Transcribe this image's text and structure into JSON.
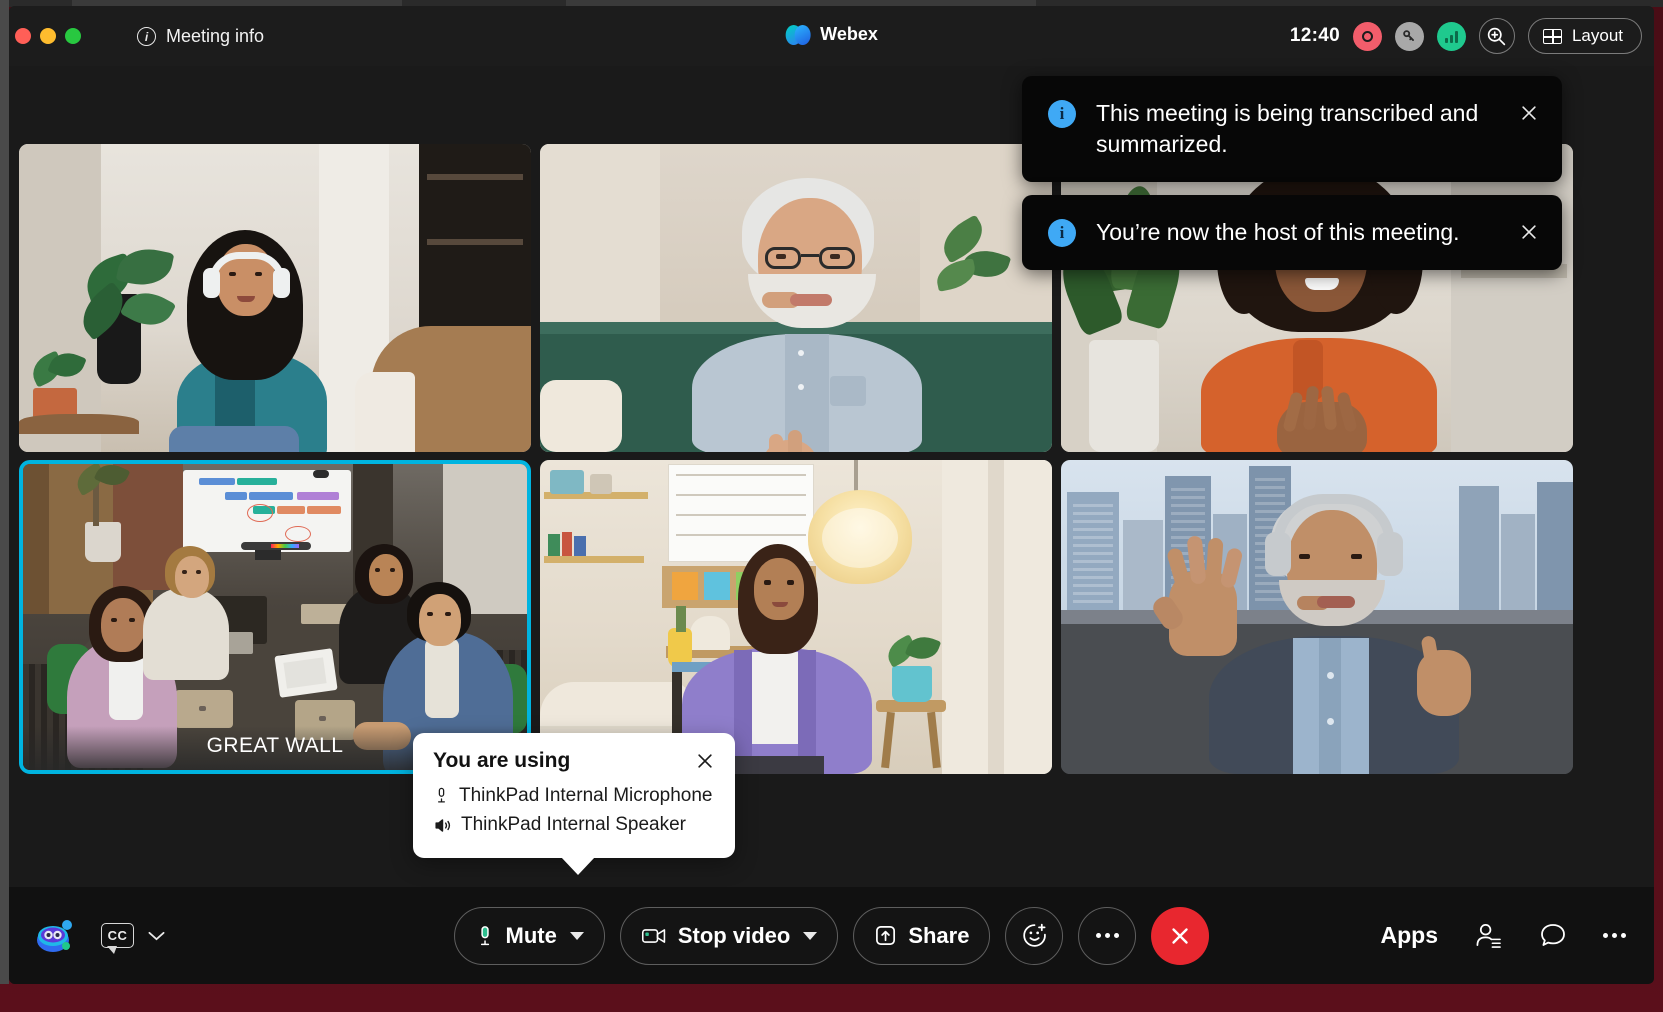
{
  "window": {
    "title_bar": {
      "traffic_lights": [
        "close",
        "minimize",
        "maximize"
      ],
      "meeting_info_label": "Meeting info",
      "brand_name": "Webex",
      "clock": "12:40",
      "status_icons": [
        "recording-indicator",
        "encryption-key-icon",
        "network-signal-icon"
      ],
      "zoom_label": "zoom-in",
      "layout_label": "Layout"
    }
  },
  "stage": {
    "tiles": [
      {
        "id": "tile-1",
        "label": "",
        "active": false
      },
      {
        "id": "tile-2",
        "label": "",
        "active": false
      },
      {
        "id": "tile-3",
        "label": "",
        "active": false
      },
      {
        "id": "tile-4",
        "label": "GREAT WALL",
        "active": true
      },
      {
        "id": "tile-5",
        "label": "",
        "active": false
      },
      {
        "id": "tile-6",
        "label": "",
        "active": false
      }
    ],
    "active_tile_label": "GREAT WALL",
    "active_border_color": "#00b4e0"
  },
  "notifications": [
    {
      "icon": "info-icon",
      "message": "This meeting is being transcribed and summarized.",
      "close_label": "Close"
    },
    {
      "icon": "info-icon",
      "message": "You’re now the host of this meeting.",
      "close_label": "Close"
    }
  ],
  "audio_popover": {
    "title": "You are using",
    "expand_label": "›",
    "close_label": "Close",
    "microphone": "ThinkPad Internal Microphone",
    "speaker": "ThinkPad Internal Speaker"
  },
  "controls": {
    "assistant_icon": "webex-ai-assistant-icon",
    "closed_captions_label": "CC",
    "mute_label": "Mute",
    "stop_video_label": "Stop video",
    "share_label": "Share",
    "reactions_label": "Reactions",
    "more_options_label": "More options",
    "leave_label": "Leave meeting",
    "apps_label": "Apps",
    "participants_label": "Participants",
    "chat_label": "Chat",
    "more_label": "More"
  },
  "colors": {
    "accent_blue": "#00b4e0",
    "leave_red": "#e8272f",
    "info_blue": "#3fa9f5",
    "recording_red": "#f25d6b",
    "signal_green": "#1fc98e",
    "bar_background": "#111111"
  }
}
